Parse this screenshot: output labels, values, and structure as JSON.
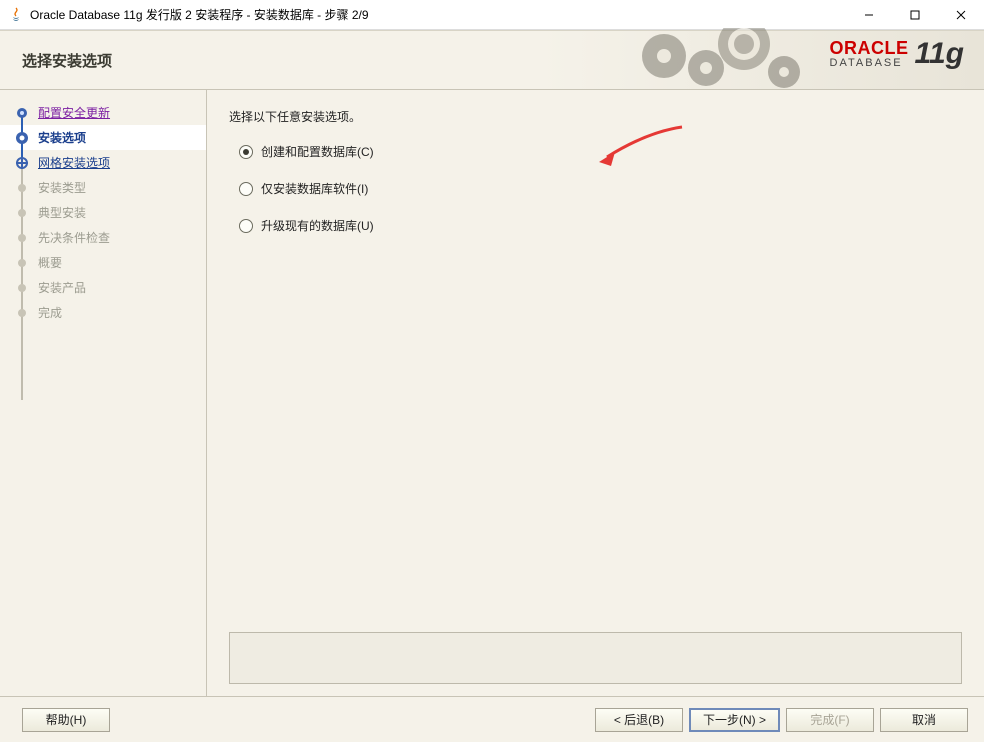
{
  "window": {
    "title": "Oracle Database 11g 发行版 2 安装程序 - 安装数据库 - 步骤 2/9"
  },
  "header": {
    "page_title": "选择安装选项",
    "brand_top": "ORACLE",
    "brand_bottom": "DATABASE",
    "brand_version": "11g"
  },
  "sidebar": {
    "steps": [
      {
        "label": "配置安全更新",
        "state": "visited"
      },
      {
        "label": "安装选项",
        "state": "current"
      },
      {
        "label": "网格安装选项",
        "state": "link"
      },
      {
        "label": "安装类型",
        "state": "disabled"
      },
      {
        "label": "典型安装",
        "state": "disabled"
      },
      {
        "label": "先决条件检查",
        "state": "disabled"
      },
      {
        "label": "概要",
        "state": "disabled"
      },
      {
        "label": "安装产品",
        "state": "disabled"
      },
      {
        "label": "完成",
        "state": "disabled"
      }
    ]
  },
  "main": {
    "instruction": "选择以下任意安装选项。",
    "options": [
      {
        "label": "创建和配置数据库(C)",
        "checked": true
      },
      {
        "label": "仅安装数据库软件(I)",
        "checked": false
      },
      {
        "label": "升级现有的数据库(U)",
        "checked": false
      }
    ]
  },
  "footer": {
    "help": "帮助(H)",
    "back": "< 后退(B)",
    "next": "下一步(N) >",
    "finish": "完成(F)",
    "cancel": "取消"
  }
}
